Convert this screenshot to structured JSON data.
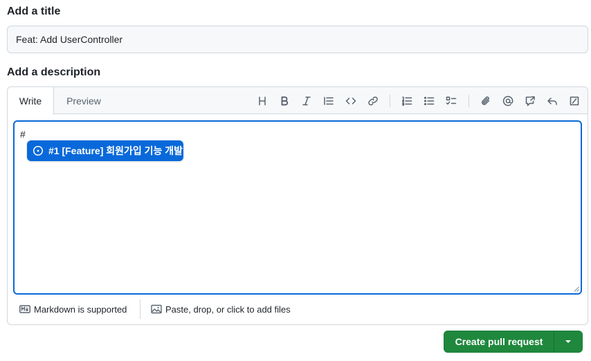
{
  "title_section": {
    "heading": "Add a title",
    "value": "Feat: Add UserController"
  },
  "description_section": {
    "heading": "Add a description",
    "tabs": [
      {
        "label": "Write",
        "active": true
      },
      {
        "label": "Preview",
        "active": false
      }
    ],
    "toolbar": [
      {
        "icon": "heading-icon"
      },
      {
        "icon": "bold-icon"
      },
      {
        "icon": "italic-icon"
      },
      {
        "icon": "quote-icon"
      },
      {
        "icon": "code-icon"
      },
      {
        "icon": "link-icon"
      },
      {
        "icon": "numbered-list-icon"
      },
      {
        "icon": "unordered-list-icon"
      },
      {
        "icon": "task-list-icon"
      },
      {
        "icon": "attach-icon"
      },
      {
        "icon": "mention-icon"
      },
      {
        "icon": "cross-reference-icon"
      },
      {
        "icon": "reply-icon"
      },
      {
        "icon": "slash-command-icon"
      }
    ],
    "textarea_value": "#",
    "suggestion": {
      "label": "#1 [Feature] 회원가입 기능 개발",
      "icon": "issue-open-icon"
    },
    "footer": {
      "markdown_label": "Markdown is supported",
      "attach_label": "Paste, drop, or click to add files"
    }
  },
  "actions": {
    "submit_label": "Create pull request"
  },
  "colors": {
    "accent": "#0969da",
    "primary_button": "#1f883d",
    "border": "#d0d7de",
    "muted_text": "#59636e"
  }
}
